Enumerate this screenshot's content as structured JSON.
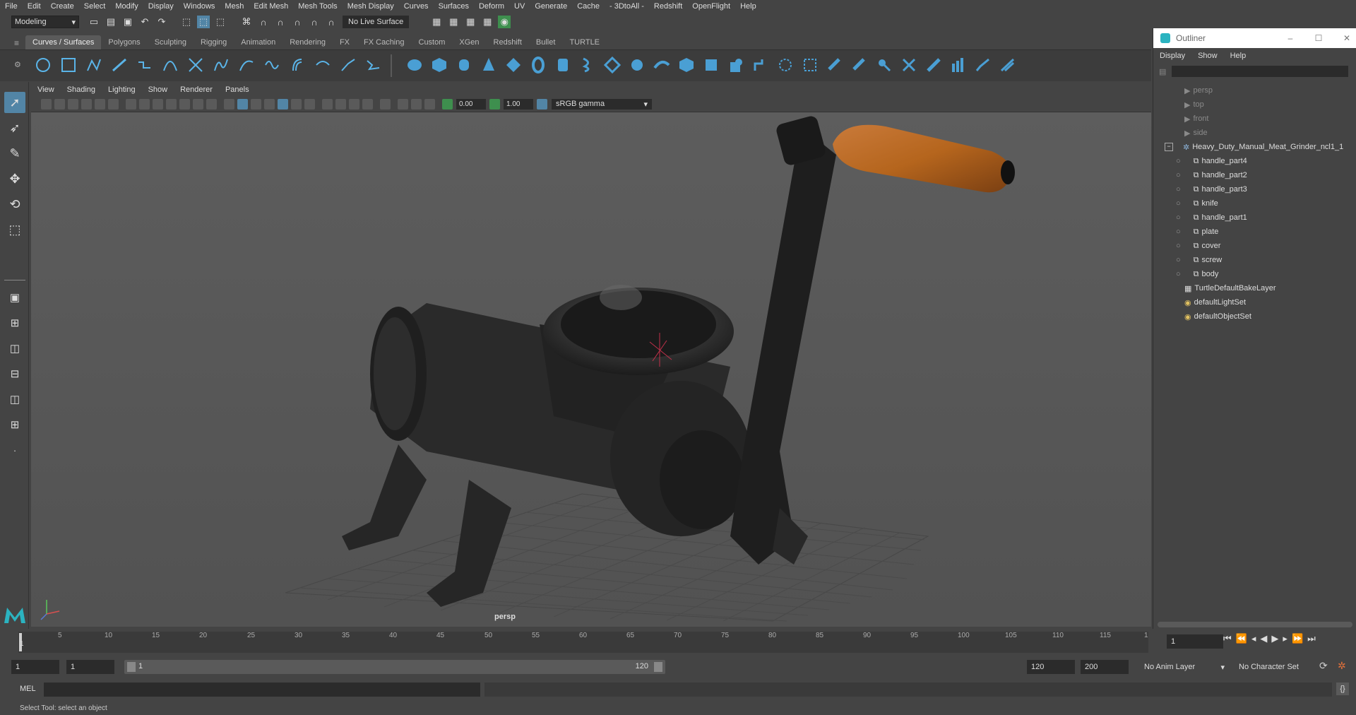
{
  "menubar": {
    "items": [
      "File",
      "Edit",
      "Create",
      "Select",
      "Modify",
      "Display",
      "Windows",
      "Mesh",
      "Edit Mesh",
      "Mesh Tools",
      "Mesh Display",
      "Curves",
      "Surfaces",
      "Deform",
      "UV",
      "Generate",
      "Cache",
      "- 3DtoAll -",
      "Redshift",
      "OpenFlight",
      "Help"
    ]
  },
  "statusline": {
    "mode": "Modeling",
    "live_surface": "No Live Surface"
  },
  "shelf": {
    "tabs": [
      "Curves / Surfaces",
      "Polygons",
      "Sculpting",
      "Rigging",
      "Animation",
      "Rendering",
      "FX",
      "FX Caching",
      "Custom",
      "XGen",
      "Redshift",
      "Bullet",
      "TURTLE"
    ],
    "active_tab": "Curves / Surfaces"
  },
  "panel": {
    "menu": [
      "View",
      "Shading",
      "Lighting",
      "Show",
      "Renderer",
      "Panels"
    ],
    "exposure": "0.00",
    "gamma_value": "1.00",
    "color_space": "sRGB gamma",
    "camera_label": "persp"
  },
  "outliner": {
    "title": "Outliner",
    "menu": [
      "Display",
      "Show",
      "Help"
    ],
    "cameras": [
      "persp",
      "top",
      "front",
      "side"
    ],
    "group": "Heavy_Duty_Manual_Meat_Grinder_ncl1_1",
    "children": [
      "handle_part4",
      "handle_part2",
      "handle_part3",
      "knife",
      "handle_part1",
      "plate",
      "cover",
      "screw",
      "body"
    ],
    "sets": [
      "TurtleDefaultBakeLayer",
      "defaultLightSet",
      "defaultObjectSet"
    ]
  },
  "timeline": {
    "ticks": [
      "5",
      "10",
      "15",
      "20",
      "25",
      "30",
      "35",
      "40",
      "45",
      "50",
      "55",
      "60",
      "65",
      "70",
      "75",
      "80",
      "85",
      "90",
      "95",
      "100",
      "105",
      "110",
      "115",
      "1"
    ],
    "current_frame": "1"
  },
  "range": {
    "start": "1",
    "playback_start": "1",
    "slider_start": "1",
    "slider_end": "120",
    "playback_end": "120",
    "end": "200",
    "anim_layer": "No Anim Layer",
    "character_set": "No Character Set"
  },
  "cmdline": {
    "label": "MEL"
  },
  "helpline": {
    "text": "Select Tool: select an object"
  },
  "colors": {
    "accent": "#5285a6",
    "ui_bg": "#444444",
    "field_bg": "#2b2b2b",
    "wood": "#b5651d"
  }
}
